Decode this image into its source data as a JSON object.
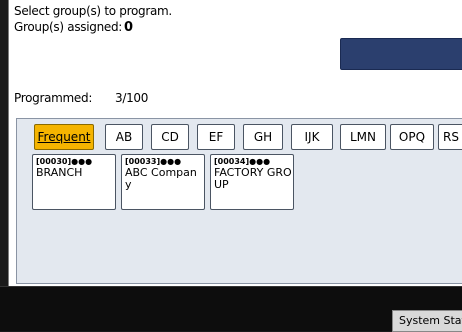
{
  "header": {
    "instruction": "Select group(s) to program.",
    "assigned_label": "Group(s) assigned:",
    "assigned_count": "0"
  },
  "programmed": {
    "label": "Programmed:",
    "value": "3/100"
  },
  "tabs": [
    {
      "label": "Frequent",
      "active": true
    },
    {
      "label": "AB"
    },
    {
      "label": "CD"
    },
    {
      "label": "EF"
    },
    {
      "label": "GH"
    },
    {
      "label": "IJK"
    },
    {
      "label": "LMN"
    },
    {
      "label": "OPQ"
    },
    {
      "label": "RS"
    }
  ],
  "entries": [
    {
      "code": "[00030]",
      "icon": "group-icon",
      "name": "BRANCH"
    },
    {
      "code": "[00033]",
      "icon": "group-icon",
      "name": "ABC Company"
    },
    {
      "code": "[00034]",
      "icon": "group-icon",
      "name": "FACTORY GROUP"
    }
  ],
  "footer": {
    "system_status": "System Status"
  },
  "colors": {
    "active_tab": "#f5b400",
    "progress_bar": "#2b3f6e"
  }
}
